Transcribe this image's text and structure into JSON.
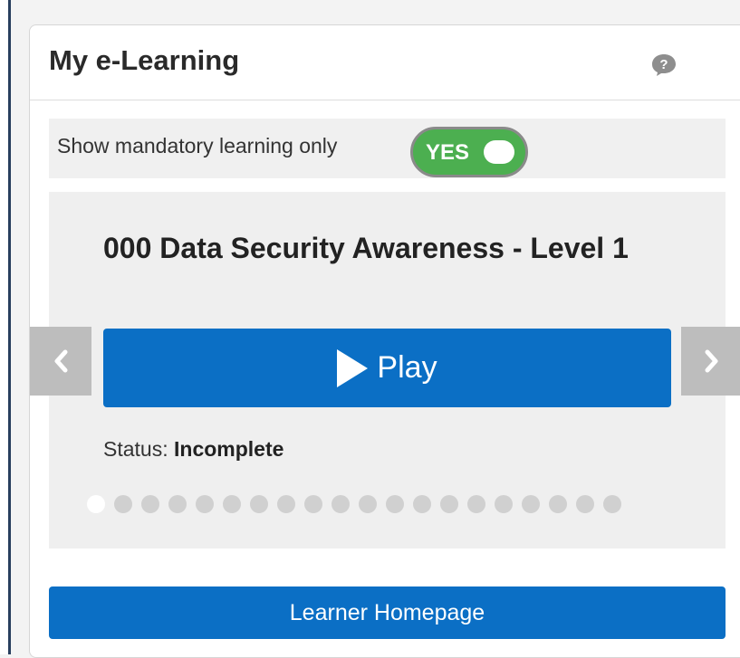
{
  "widget": {
    "title": "My e-Learning",
    "help_icon": "help-question-bubble-icon"
  },
  "filter": {
    "label": "Show mandatory learning only",
    "toggle_text": "YES",
    "toggle_on": true,
    "toggle_color": "#4caf50"
  },
  "course": {
    "title": "000 Data Security Awareness - Level 1",
    "play_label": "Play",
    "status_label": "Status:",
    "status_value": "Incomplete"
  },
  "carousel": {
    "prev_icon": "chevron-left-icon",
    "next_icon": "chevron-right-icon",
    "dot_count": 20,
    "active_dot": 0
  },
  "footer": {
    "learner_homepage_label": "Learner Homepage"
  },
  "colors": {
    "accent": "#0b6fc5",
    "nav_arrow_bg": "#bdbdbd"
  }
}
